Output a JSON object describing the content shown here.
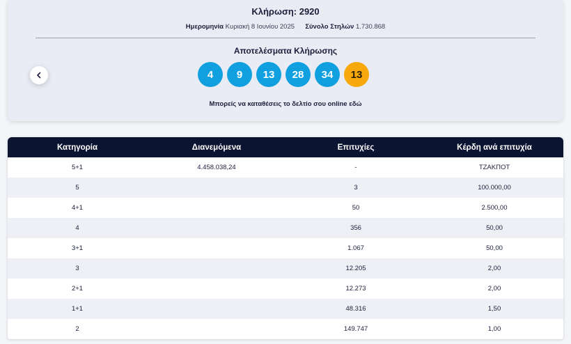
{
  "draw": {
    "title": "Κλήρωση: 2920",
    "date_label": "Ημερομηνία",
    "date_value": "Κυριακή 8 Ιουνίου 2025",
    "columns_label": "Σύνολο Στηλών",
    "columns_value": "1.730.868",
    "results_title": "Αποτελέσματα Κλήρωσης",
    "numbers": [
      "4",
      "9",
      "13",
      "28",
      "34"
    ],
    "joker": "13",
    "online_text": "Μπορείς να καταθέσεις το δελτίο σου online εδώ",
    "prev_icon": "chevron-left-icon"
  },
  "table": {
    "headers": [
      "Κατηγορία",
      "Διανεμόμενα",
      "Επιτυχίες",
      "Κέρδη ανά επιτυχία"
    ],
    "rows": [
      [
        "5+1",
        "4.458.038,24",
        "-",
        "ΤΖΑΚΠΟΤ"
      ],
      [
        "5",
        "",
        "3",
        "100.000,00"
      ],
      [
        "4+1",
        "",
        "50",
        "2.500,00"
      ],
      [
        "4",
        "",
        "356",
        "50,00"
      ],
      [
        "3+1",
        "",
        "1.067",
        "50,00"
      ],
      [
        "3",
        "",
        "12.205",
        "2,00"
      ],
      [
        "2+1",
        "",
        "12.273",
        "2,00"
      ],
      [
        "1+1",
        "",
        "48.316",
        "1,50"
      ],
      [
        "2",
        "",
        "149.747",
        "1,00"
      ]
    ]
  },
  "colors": {
    "ball_main": "#10a0e0",
    "ball_joker": "#f6a80c",
    "table_header": "#0b1431"
  }
}
